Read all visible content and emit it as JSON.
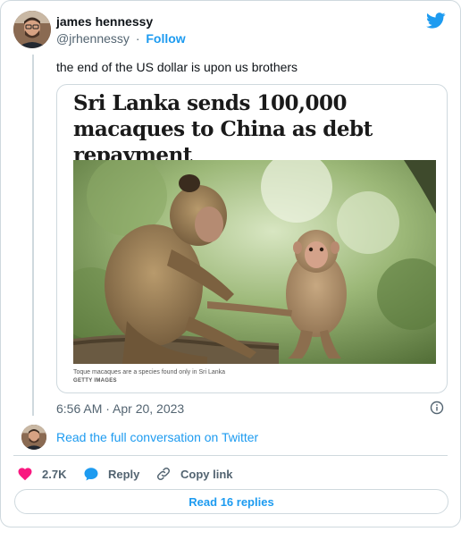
{
  "author": {
    "name": "james hennessy",
    "handle": "@jrhennessy",
    "separator": "·",
    "follow_label": "Follow"
  },
  "tweet": {
    "text": "the end of the US dollar is upon us brothers",
    "timestamp": "6:56 AM · Apr 20, 2023"
  },
  "embed": {
    "headline": "Sri Lanka sends 100,000 macaques to China as debt repayment",
    "caption": "Toque macaques are a species found only in Sri Lanka",
    "credit": "GETTY IMAGES"
  },
  "conversation_link": "Read the full conversation on Twitter",
  "actions": {
    "like_count": "2.7K",
    "reply_label": "Reply",
    "copy_label": "Copy link"
  },
  "read_replies_label": "Read 16 replies",
  "colors": {
    "accent": "#1d9bf0",
    "like": "#f91880",
    "muted": "#536471",
    "border": "#cfd9de"
  },
  "icons": [
    "twitter-bird-icon",
    "info-icon",
    "heart-icon",
    "reply-bubble-icon",
    "link-icon"
  ]
}
